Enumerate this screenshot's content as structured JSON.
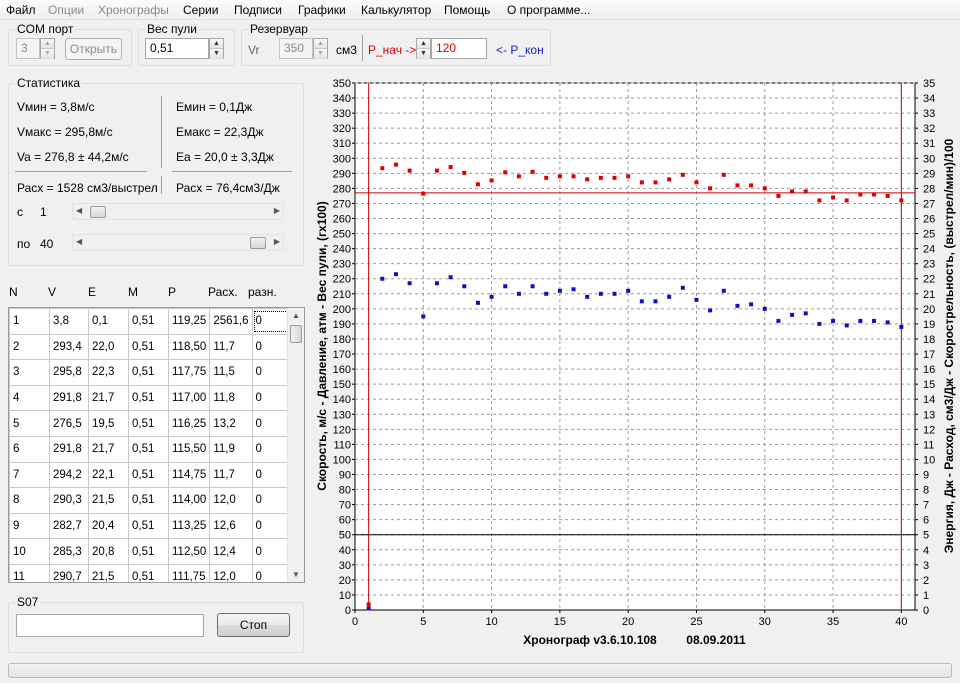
{
  "menu": [
    {
      "label": "Файл",
      "disabled": false
    },
    {
      "label": "Опции",
      "disabled": true
    },
    {
      "label": "Хронографы",
      "disabled": true
    },
    {
      "label": "Серии",
      "disabled": false
    },
    {
      "label": "Подписи",
      "disabled": false
    },
    {
      "label": "Графики",
      "disabled": false
    },
    {
      "label": "Калькулятор",
      "disabled": false
    },
    {
      "label": "Помощь",
      "disabled": false
    },
    {
      "label": "О программе...",
      "disabled": false
    }
  ],
  "com_port": {
    "title": "COM порт",
    "value": "3",
    "open_button": "Открыть"
  },
  "bullet_weight": {
    "title": "Вес пули",
    "value": "0,51"
  },
  "reservoir": {
    "title": "Резервуар",
    "vr_label": "Vr",
    "volume": "350",
    "unit": "см3",
    "p_start_label": "P_нач ->",
    "pressure": "120",
    "p_end_label": "<- P_кон"
  },
  "stats": {
    "title": "Статистика",
    "vmin": "Vмин = 3,8м/с",
    "vmax": "Vмакс = 295,8м/с",
    "va": "Va = 276,8 ± 44,2м/с",
    "emin": "Емин = 0,1Дж",
    "emax": "Емакс = 22,3Дж",
    "ea": "Еа = 20,0 ± 3,3Дж",
    "consumption": "Расх = 1528 см3/выстрел",
    "consumption_energy": "Расх = 76,4см3/Дж",
    "from_label": "с",
    "from_value": "1",
    "from_position": 0,
    "to_label": "по",
    "to_value": "40",
    "to_position": 1
  },
  "table": {
    "headers": [
      "N",
      "V",
      "E",
      "M",
      "P",
      "Расх.",
      "разн."
    ],
    "rows": [
      [
        "1",
        "3,8",
        "0,1",
        "0,51",
        "119,25",
        "2561,6",
        "0"
      ],
      [
        "2",
        "293,4",
        "22,0",
        "0,51",
        "118,50",
        "11,7",
        "0"
      ],
      [
        "3",
        "295,8",
        "22,3",
        "0,51",
        "117,75",
        "11,5",
        "0"
      ],
      [
        "4",
        "291,8",
        "21,7",
        "0,51",
        "117,00",
        "11,8",
        "0"
      ],
      [
        "5",
        "276,5",
        "19,5",
        "0,51",
        "116,25",
        "13,2",
        "0"
      ],
      [
        "6",
        "291,8",
        "21,7",
        "0,51",
        "115,50",
        "11,9",
        "0"
      ],
      [
        "7",
        "294,2",
        "22,1",
        "0,51",
        "114,75",
        "11,7",
        "0"
      ],
      [
        "8",
        "290,3",
        "21,5",
        "0,51",
        "114,00",
        "12,0",
        "0"
      ],
      [
        "9",
        "282,7",
        "20,4",
        "0,51",
        "113,25",
        "12,6",
        "0"
      ],
      [
        "10",
        "285,3",
        "20,8",
        "0,51",
        "112,50",
        "12,4",
        "0"
      ],
      [
        "11",
        "290,7",
        "21,5",
        "0,51",
        "111,75",
        "12,0",
        "0"
      ]
    ]
  },
  "bottom": {
    "title": "S07",
    "input_value": "",
    "stop_button": "Стоп"
  },
  "chart_data": {
    "type": "scatter",
    "xlim": [
      0,
      41
    ],
    "ylim": [
      0,
      350
    ],
    "y2lim": [
      0,
      35
    ],
    "x_ticks": [
      0,
      5,
      10,
      15,
      20,
      25,
      30,
      35,
      40
    ],
    "ylabel": "Скорость, м/с  - Давление, атм - Вес пули, (гх100)",
    "y2label": "Энергия, Дж  -  Расход, см3/Дж - Скорострельность, (выстрел/мин)/100",
    "footer_title": "Хронограф v3.6.10.108",
    "footer_date": "08.09.2011",
    "grid": true,
    "series": [
      {
        "color": "#dd0000",
        "x": [
          1,
          2,
          3,
          4,
          5,
          6,
          7,
          8,
          9,
          10,
          11,
          12,
          13,
          14,
          15,
          16,
          17,
          18,
          19,
          20,
          21,
          22,
          23,
          24,
          25,
          26,
          27,
          28,
          29,
          30,
          31,
          32,
          33,
          34,
          35,
          36,
          37,
          38,
          39,
          40
        ],
        "y": [
          3.8,
          293.4,
          295.8,
          291.8,
          276.5,
          291.8,
          294.2,
          290.3,
          282.7,
          285.3,
          290.7,
          288,
          291,
          287,
          288,
          288,
          286,
          287,
          287,
          288,
          284,
          284,
          286,
          289,
          284,
          280,
          289,
          282,
          282,
          280,
          275,
          278,
          278,
          272,
          274,
          272,
          276,
          276,
          275,
          272
        ]
      },
      {
        "color": "#1010c0",
        "x": [
          1,
          2,
          3,
          4,
          5,
          6,
          7,
          8,
          9,
          10,
          11,
          12,
          13,
          14,
          15,
          16,
          17,
          18,
          19,
          20,
          21,
          22,
          23,
          24,
          25,
          26,
          27,
          28,
          29,
          30,
          31,
          32,
          33,
          34,
          35,
          36,
          37,
          38,
          39,
          40
        ],
        "y": [
          0.1,
          22.0,
          22.3,
          21.7,
          19.5,
          21.7,
          22.1,
          21.5,
          20.4,
          20.8,
          21.5,
          21.0,
          21.5,
          21.0,
          21.2,
          21.3,
          20.8,
          21.0,
          21.0,
          21.2,
          20.5,
          20.5,
          20.8,
          21.4,
          20.6,
          19.9,
          21.2,
          20.2,
          20.3,
          20.0,
          19.2,
          19.6,
          19.7,
          19.0,
          19.2,
          18.9,
          19.2,
          19.2,
          19.1,
          18.8
        ],
        "axis": "right"
      }
    ],
    "vertical_lines": [
      {
        "x": 1,
        "color": "#cc0000"
      },
      {
        "x": 40,
        "color": "#cc0000"
      }
    ],
    "horizontal_lines": [
      {
        "y": 277,
        "color": "#cc0000"
      },
      {
        "y": 50,
        "color": "#000000"
      }
    ]
  }
}
